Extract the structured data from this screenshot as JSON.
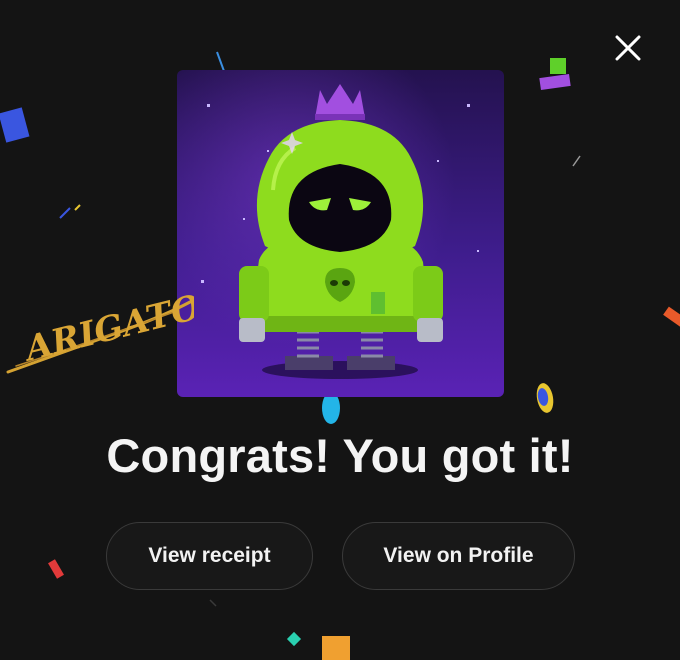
{
  "dialog": {
    "title": "Congrats! You got it!",
    "close_icon": "close-icon",
    "signature_text": "ARIGATO"
  },
  "actions": {
    "view_receipt_label": "View receipt",
    "view_profile_label": "View on Profile"
  },
  "colors": {
    "background": "#141414",
    "title_text": "#f4f4f4",
    "button_border": "#3a3a3a",
    "hoodie_green": "#8edc1e",
    "crown_purple": "#a24fe0",
    "art_bg_top": "#2a1560",
    "art_bg_bottom": "#5a22b5",
    "signature_gold": "#d4a232"
  }
}
